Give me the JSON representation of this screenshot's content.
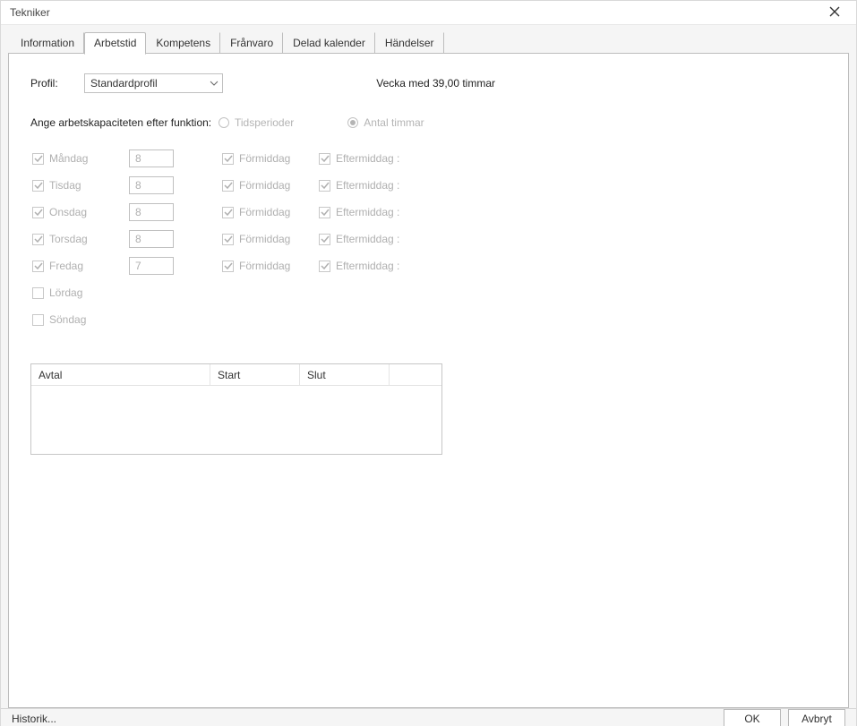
{
  "window": {
    "title": "Tekniker"
  },
  "tabs": [
    {
      "label": "Information",
      "active": false
    },
    {
      "label": "Arbetstid",
      "active": true
    },
    {
      "label": "Kompetens",
      "active": false
    },
    {
      "label": "Frånvaro",
      "active": false
    },
    {
      "label": "Delad kalender",
      "active": false
    },
    {
      "label": "Händelser",
      "active": false
    }
  ],
  "profile": {
    "label": "Profil:",
    "value": "Standardprofil",
    "week_summary": "Vecka med 39,00 timmar"
  },
  "capacity": {
    "label": "Ange arbetskapaciteten efter funktion:",
    "options": [
      {
        "label": "Tidsperioder",
        "selected": false
      },
      {
        "label": "Antal timmar",
        "selected": true
      }
    ]
  },
  "days": [
    {
      "name": "Måndag",
      "checked": true,
      "hours": "8",
      "fm": true,
      "em": true,
      "fm_label": "Förmiddag",
      "em_label": "Eftermiddag :"
    },
    {
      "name": "Tisdag",
      "checked": true,
      "hours": "8",
      "fm": true,
      "em": true,
      "fm_label": "Förmiddag",
      "em_label": "Eftermiddag :"
    },
    {
      "name": "Onsdag",
      "checked": true,
      "hours": "8",
      "fm": true,
      "em": true,
      "fm_label": "Förmiddag",
      "em_label": "Eftermiddag :"
    },
    {
      "name": "Torsdag",
      "checked": true,
      "hours": "8",
      "fm": true,
      "em": true,
      "fm_label": "Förmiddag",
      "em_label": "Eftermiddag :"
    },
    {
      "name": "Fredag",
      "checked": true,
      "hours": "7",
      "fm": true,
      "em": true,
      "fm_label": "Förmiddag",
      "em_label": "Eftermiddag :"
    },
    {
      "name": "Lördag",
      "checked": false
    },
    {
      "name": "Söndag",
      "checked": false
    }
  ],
  "table": {
    "columns": [
      "Avtal",
      "Start",
      "Slut"
    ]
  },
  "footer": {
    "history": "Historik...",
    "ok": "OK",
    "cancel": "Avbryt"
  }
}
